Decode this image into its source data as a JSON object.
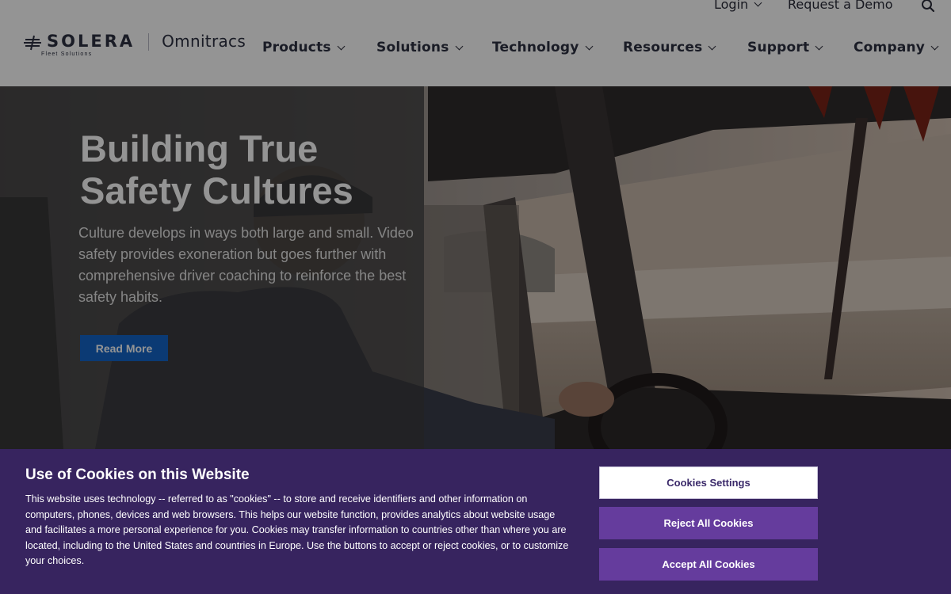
{
  "header": {
    "utility": {
      "login": "Login",
      "request_demo": "Request a Demo",
      "search_icon": "search-icon"
    },
    "logo": {
      "brand": "SOLERA",
      "tagline": "Fleet Solutions",
      "product": "Omnitracs"
    },
    "nav": [
      {
        "label": "Products"
      },
      {
        "label": "Solutions"
      },
      {
        "label": "Technology"
      },
      {
        "label": "Resources"
      },
      {
        "label": "Support"
      },
      {
        "label": "Company"
      }
    ]
  },
  "hero": {
    "title": "Building True Safety Cultures",
    "body": "Culture develops in ways both large and small. Video safety provides exoneration but goes further with comprehensive driver coaching to reinforce the best safety habits.",
    "cta": "Read More",
    "accent_color": "#1465c8"
  },
  "cookie_banner": {
    "title": "Use of Cookies on this Website",
    "text": "This website uses technology -- referred to as \"cookies\" -- to store and receive identifiers and other information on computers, phones, devices and web browsers. This helps our website function, provides analytics about website usage and facilitates a more personal experience for you. Cookies may transfer information to countries other than where you are located, including to the United States and countries in Europe. Use the buttons to accept or reject cookies, or to customize your choices.",
    "settings_button": "Cookies Settings",
    "reject_button": "Reject All Cookies",
    "accept_button": "Accept All Cookies",
    "background_color": "#37245f",
    "button_color": "#653c9d"
  }
}
